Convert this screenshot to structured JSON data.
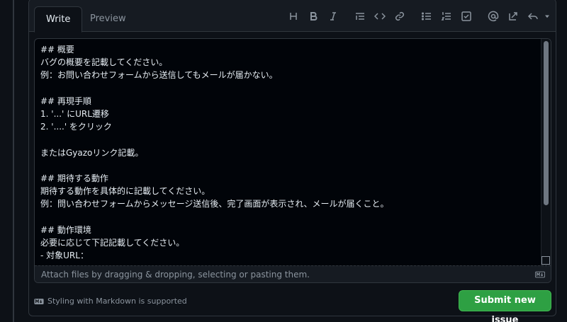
{
  "tabs": [
    {
      "label": "Write",
      "active": true
    },
    {
      "label": "Preview",
      "active": false
    }
  ],
  "toolbar": {
    "items": [
      "heading-icon",
      "bold-icon",
      "italic-icon",
      "quote-icon",
      "code-icon",
      "link-icon",
      "unordered-list-icon",
      "ordered-list-icon",
      "task-list-icon",
      "mention-icon",
      "reference-icon",
      "reply-icon"
    ]
  },
  "editor": {
    "content": "## 概要\nバグの概要を記載してください。\n例：お問い合わせフォームから送信してもメールが届かない。\n\n## 再現手順\n1. '...' にURL遷移\n2. '....' をクリック\n\nまたはGyazoリンク記載。\n\n## 期待する動作\n期待する動作を具体的に記載してください。\n例：問い合わせフォームからメッセージ送信後、完了画面が表示され、メールが届くこと。\n\n## 動作環境\n必要に応じて下記記載してください。\n- 対象URL："
  },
  "attach": {
    "text": "Attach files by dragging & dropping, selecting or pasting them."
  },
  "footer": {
    "markdown_note": "Styling with Markdown is supported"
  },
  "submit": {
    "label": "Submit new issue"
  },
  "colors": {
    "accent": "#2ea043",
    "background": "#0d1117",
    "border": "#30363d"
  }
}
